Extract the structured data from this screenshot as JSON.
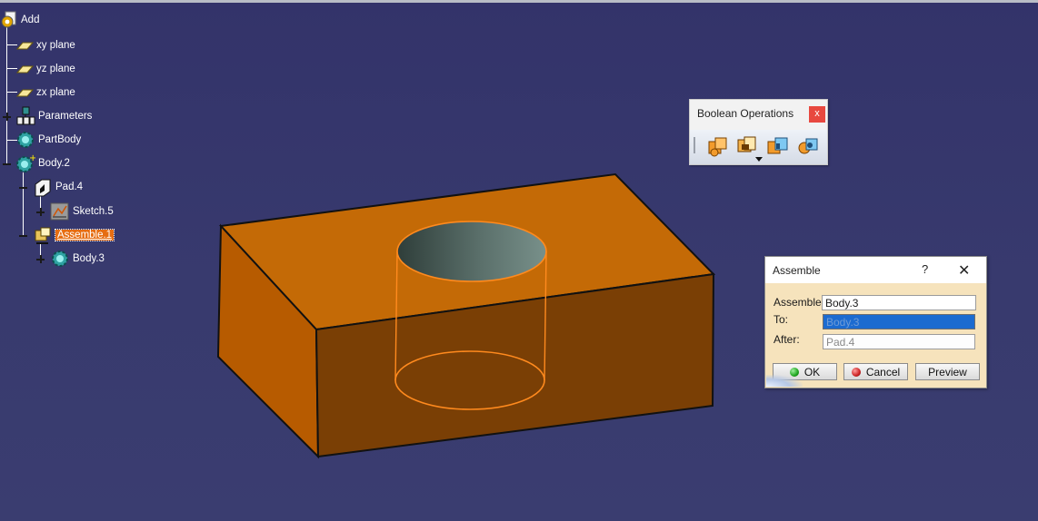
{
  "tree": {
    "items": [
      {
        "label": "Add",
        "icon": "part-gear-icon"
      },
      {
        "label": "xy plane",
        "icon": "plane-icon"
      },
      {
        "label": "yz plane",
        "icon": "plane-icon"
      },
      {
        "label": "zx plane",
        "icon": "plane-icon"
      },
      {
        "label": "Parameters",
        "icon": "parameters-icon"
      },
      {
        "label": "PartBody",
        "icon": "body-gear-icon"
      },
      {
        "label": "Body.2",
        "icon": "body-gear-icon"
      },
      {
        "label": "Pad.4",
        "icon": "pad-icon"
      },
      {
        "label": "Sketch.5",
        "icon": "sketch-icon"
      },
      {
        "label": "Assemble.1",
        "icon": "assemble-icon",
        "selected": true
      },
      {
        "label": "Body.3",
        "icon": "body-gear-icon"
      }
    ]
  },
  "boolean_toolbar": {
    "title": "Boolean Operations",
    "close_label": "x",
    "buttons": [
      "assemble-icon",
      "add-icon",
      "remove-icon",
      "intersect-icon"
    ]
  },
  "assemble_dialog": {
    "title": "Assemble",
    "help_label": "?",
    "close_label": "✕",
    "assemble_label": "Assemble",
    "assemble_value": "Body.3",
    "to_label": "To:",
    "to_value": "Body.3",
    "after_label": "After:",
    "after_value": "Pad.4",
    "ok_label": "OK",
    "cancel_label": "Cancel",
    "preview_label": "Preview"
  },
  "colors": {
    "background": "#383a6e",
    "block_top": "#c46a06",
    "block_front": "#7a3f05",
    "block_side": "#b75b00",
    "hole_highlight": "#ff8a1e",
    "selection": "#e66d12",
    "ok_dot": "#22aa22",
    "cancel_dot": "#cc2222"
  }
}
